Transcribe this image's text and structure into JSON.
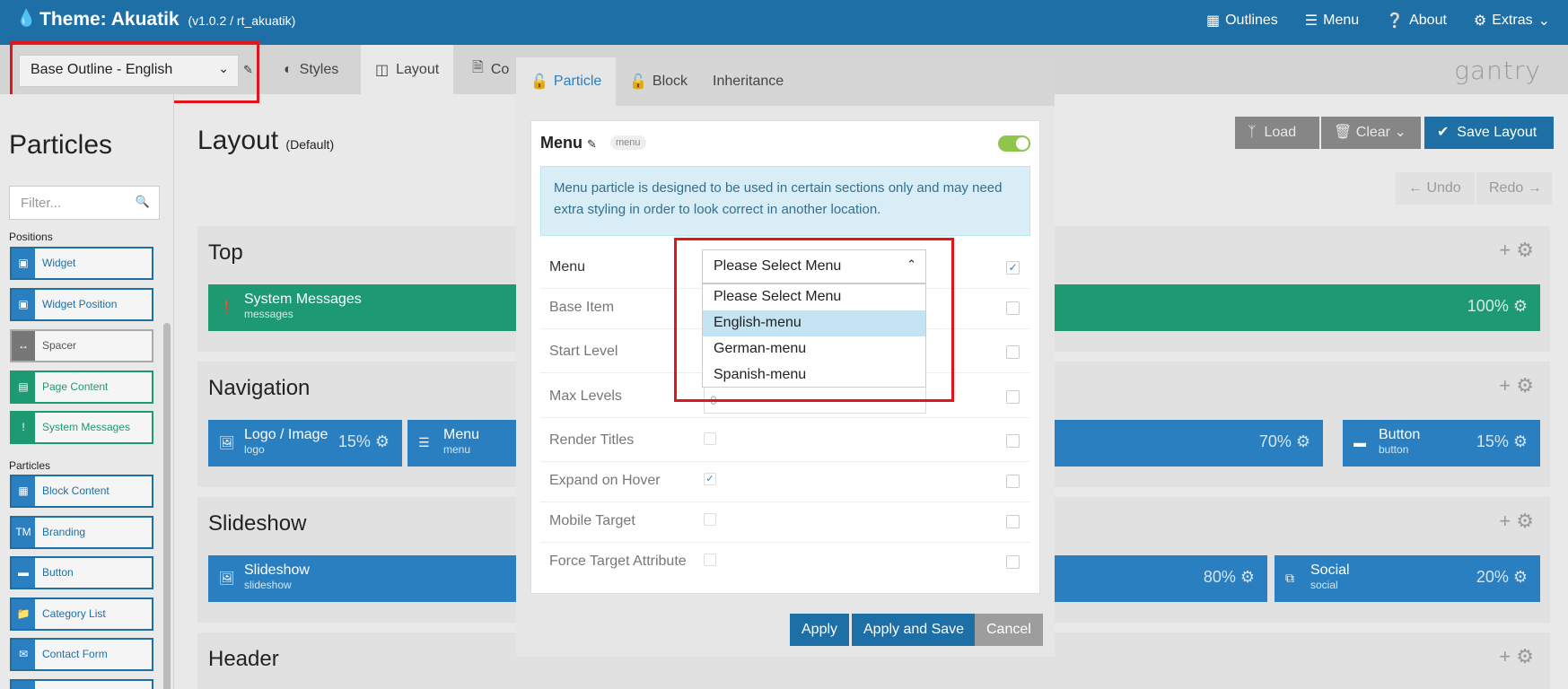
{
  "topbar": {
    "theme_title": "Theme: Akuatik",
    "theme_version": "(v1.0.2 / rt_akuatik)",
    "nav": [
      {
        "icon": "grid-icon",
        "label": "Outlines"
      },
      {
        "icon": "menu-icon",
        "label": "Menu"
      },
      {
        "icon": "question-icon",
        "label": "About"
      },
      {
        "icon": "gear-icon",
        "label": "Extras"
      }
    ]
  },
  "subbar": {
    "outline": "Base Outline - English",
    "tabs": [
      "Styles",
      "Layout",
      "Co"
    ],
    "brand": "gantry"
  },
  "sidebar": {
    "title": "Particles",
    "filter_placeholder": "Filter...",
    "positions_label": "Positions",
    "positions": [
      "Widget",
      "Widget Position",
      "Spacer",
      "Page Content",
      "System Messages"
    ],
    "particles_label": "Particles",
    "particles": [
      "Block Content",
      "Branding",
      "Button",
      "Category List",
      "Contact Form"
    ]
  },
  "main": {
    "title": "Layout",
    "subtitle": "(Default)",
    "load": "Load",
    "clear": "Clear",
    "save_layout": "Save Layout",
    "undo": "Undo",
    "redo": "Redo",
    "sections": [
      {
        "name": "Top",
        "blocks": [
          {
            "title": "System Messages",
            "sub": "messages",
            "pct": "100%"
          }
        ]
      },
      {
        "name": "Navigation",
        "blocks": [
          {
            "title": "Logo / Image",
            "sub": "logo",
            "pct": "15%"
          },
          {
            "title": "Menu",
            "sub": "menu",
            "pct": "70%"
          },
          {
            "title": "Button",
            "sub": "button",
            "pct": "15%"
          }
        ]
      },
      {
        "name": "Slideshow",
        "blocks": [
          {
            "title": "Slideshow",
            "sub": "slideshow",
            "pct": "80%"
          },
          {
            "title": "Social",
            "sub": "social",
            "pct": "20%"
          }
        ]
      },
      {
        "name": "Header",
        "blocks": []
      }
    ]
  },
  "modal": {
    "tabs": [
      "Particle",
      "Block",
      "Inheritance"
    ],
    "particle_title": "Menu",
    "badge": "menu",
    "info": "Menu particle is designed to be used in certain sections only and may need extra styling in order to look correct in another location.",
    "fields": [
      {
        "label": "Menu"
      },
      {
        "label": "Base Item"
      },
      {
        "label": "Start Level"
      },
      {
        "label": "Max Levels",
        "value": "0"
      },
      {
        "label": "Render Titles"
      },
      {
        "label": "Expand on Hover"
      },
      {
        "label": "Mobile Target"
      },
      {
        "label": "Force Target Attribute"
      }
    ],
    "select_value": "Please Select Menu",
    "options": [
      "Please Select Menu",
      "English-menu",
      "German-menu",
      "Spanish-menu"
    ],
    "apply": "Apply",
    "apply_save": "Apply and Save",
    "cancel": "Cancel"
  }
}
